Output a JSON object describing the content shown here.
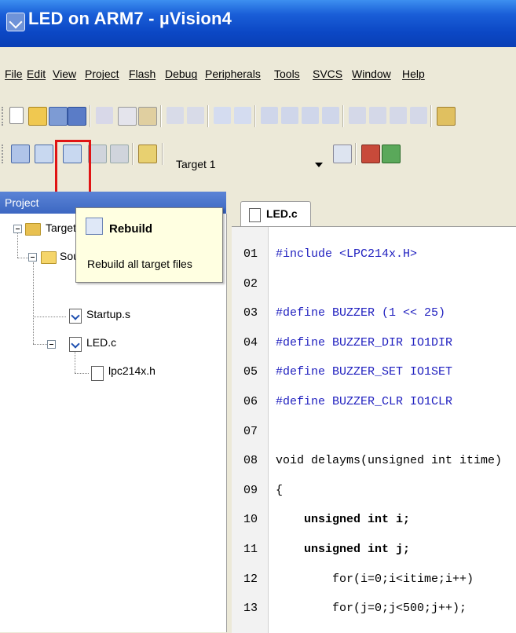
{
  "window": {
    "title": "LED on ARM7  - µVision4"
  },
  "menu": [
    "File",
    "Edit",
    "View",
    "Project",
    "Flash",
    "Debug",
    "Peripherals",
    "Tools",
    "SVCS",
    "Window",
    "Help"
  ],
  "toolbar": {
    "target_combo": "Target 1",
    "buttons_row1": [
      "new-file",
      "open-file",
      "save",
      "save-all",
      "cut",
      "copy",
      "paste",
      "undo",
      "redo",
      "back",
      "forward",
      "bookmark",
      "bookmark-prev",
      "bookmark-next",
      "bookmark-clear",
      "indent",
      "unindent",
      "comment",
      "uncomment",
      "find-in-files"
    ],
    "buttons_row2": [
      "translate",
      "build",
      "rebuild",
      "batch-build",
      "stop-build",
      "download",
      "target-combo",
      "target-options",
      "manage-project",
      "manage-books"
    ]
  },
  "tooltip": {
    "title": "Rebuild",
    "description": "Rebuild all target files"
  },
  "project_panel": {
    "header": "Project",
    "tree": {
      "target": "Target 1",
      "group": "Source Group 1",
      "files": [
        "Startup.s",
        "LED.c"
      ],
      "includes": [
        "lpc214x.h"
      ]
    }
  },
  "editor": {
    "tab": "LED.c",
    "line_numbers": [
      "01",
      "02",
      "03",
      "04",
      "05",
      "06",
      "07",
      "08",
      "09",
      "10",
      "11",
      "12",
      "13"
    ],
    "lines": [
      "#include <LPC214x.H>",
      "",
      "#define BUZZER (1 << 25)",
      "#define BUZZER_DIR IO1DIR",
      "#define BUZZER_SET IO1SET",
      "#define BUZZER_CLR IO1CLR",
      "",
      "void delayms(unsigned int itime)",
      "{",
      "    unsigned int i;",
      "    unsigned int j;",
      "        for(i=0;i<itime;i++)",
      "        for(j=0;j<500;j++);"
    ]
  }
}
